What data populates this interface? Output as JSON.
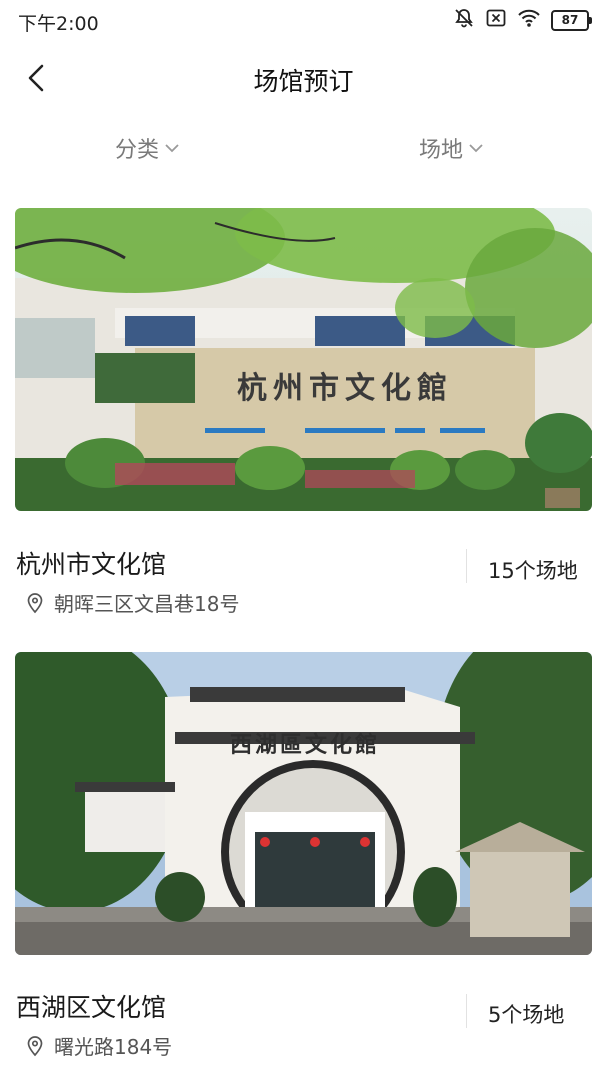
{
  "status": {
    "time": "下午2:00",
    "battery": "87"
  },
  "nav": {
    "title": "场馆预订"
  },
  "filters": {
    "category": "分类",
    "venue": "场地"
  },
  "venues": [
    {
      "name": "杭州市文化馆",
      "address": "朝晖三区文昌巷18号",
      "count": "15个场地",
      "sign": "杭州市文化館"
    },
    {
      "name": "西湖区文化馆",
      "address": "曙光路184号",
      "count": "5个场地",
      "sign": "西湖區文化館"
    }
  ]
}
